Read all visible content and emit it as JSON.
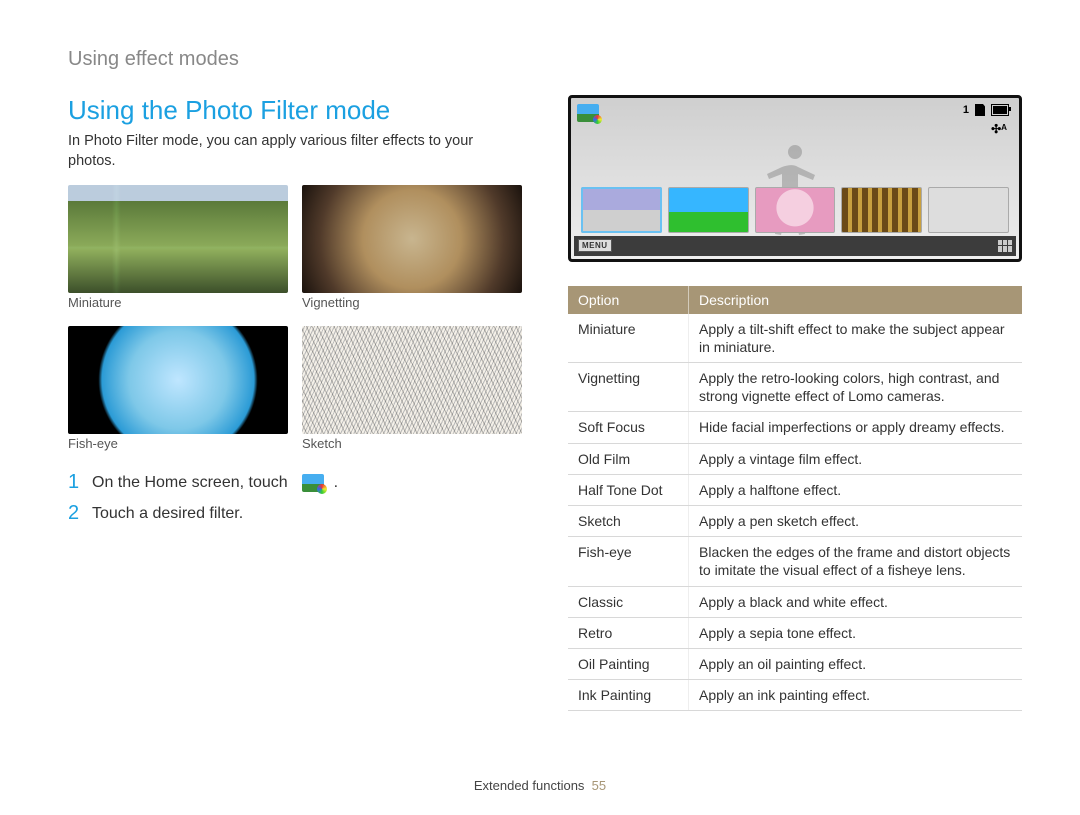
{
  "breadcrumb": "Using effect modes",
  "heading": "Using the Photo Filter mode",
  "intro": "In Photo Filter mode, you can apply various filter effects to your photos.",
  "samples": {
    "miniature": "Miniature",
    "vignetting": "Vignetting",
    "fisheye": "Fish-eye",
    "sketch": "Sketch"
  },
  "steps": {
    "s1": {
      "num": "1",
      "text_a": "On the Home screen, touch",
      "text_b": "."
    },
    "s2": {
      "num": "2",
      "text": "Touch a desired filter."
    }
  },
  "camera": {
    "count": "1",
    "flash": "✣ᴬ",
    "menu": "MENU"
  },
  "table": {
    "headers": {
      "option": "Option",
      "description": "Description"
    },
    "rows": [
      {
        "option": "Miniature",
        "description": "Apply a tilt-shift effect to make the subject appear in miniature."
      },
      {
        "option": "Vignetting",
        "description": "Apply the retro-looking colors, high contrast, and strong vignette effect of Lomo cameras."
      },
      {
        "option": "Soft Focus",
        "description": "Hide facial imperfections or apply dreamy effects."
      },
      {
        "option": "Old Film",
        "description": "Apply a vintage film effect."
      },
      {
        "option": "Half Tone Dot",
        "description": "Apply a halftone effect."
      },
      {
        "option": "Sketch",
        "description": "Apply a pen sketch effect."
      },
      {
        "option": "Fish-eye",
        "description": "Blacken the edges of the frame and distort objects to imitate the visual effect of a fisheye lens."
      },
      {
        "option": "Classic",
        "description": "Apply a black and white effect."
      },
      {
        "option": "Retro",
        "description": "Apply a sepia tone effect."
      },
      {
        "option": "Oil Painting",
        "description": "Apply an oil painting effect."
      },
      {
        "option": "Ink Painting",
        "description": "Apply an ink painting effect."
      }
    ]
  },
  "footer": {
    "section": "Extended functions",
    "page": "55"
  }
}
